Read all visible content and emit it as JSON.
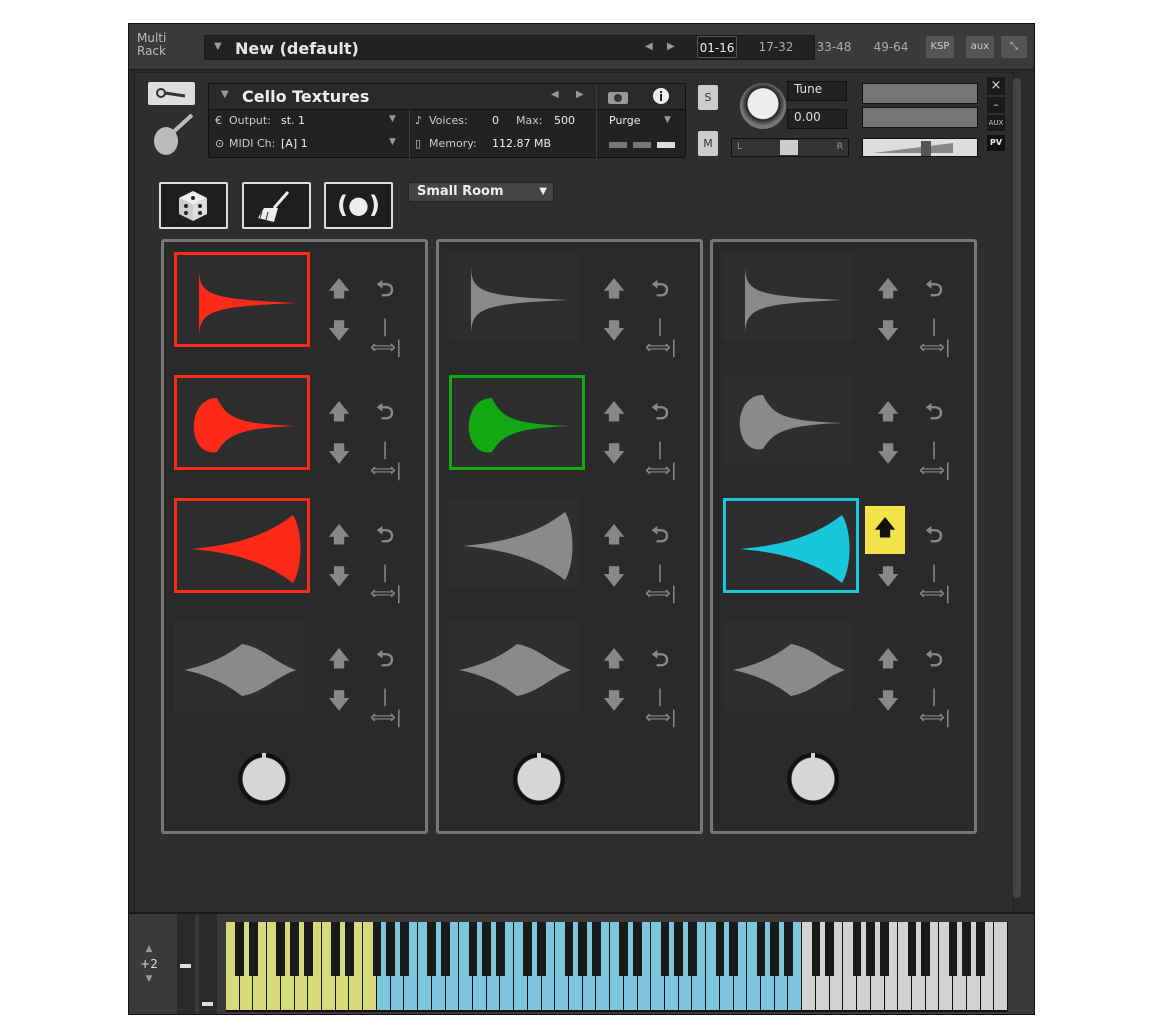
{
  "rack": {
    "title_line1": "Multi",
    "title_line2": "Rack",
    "name": "New (default)",
    "pages": [
      "01-16",
      "17-32",
      "33-48",
      "49-64"
    ],
    "active_page": "01-16",
    "ksp_label": "KSP",
    "aux_label": "aux"
  },
  "instrument": {
    "name": "Cello Textures",
    "output_label": "Output:",
    "output_value": "st. 1",
    "voices_label": "Voices:",
    "voices_value": "0",
    "max_label": "Max:",
    "max_value": "500",
    "midi_label": "MIDI Ch:",
    "midi_value": "[A]  1",
    "memory_label": "Memory:",
    "memory_value": "112.87 MB",
    "purge_label": "Purge",
    "solo_label": "S",
    "mute_label": "M",
    "tune_label": "Tune",
    "tune_value": "0.00",
    "pan_left": "L",
    "pan_right": "R",
    "aux_small": "AUX",
    "pv_label": "PV",
    "close_glyph": "×",
    "minimize_glyph": "–"
  },
  "controls": {
    "reverb_preset": "Small Room",
    "reverb_icon_text": "(●)"
  },
  "columns": [
    {
      "selected_slots": [
        0,
        1,
        2
      ],
      "selection_color": "#ff2a1a",
      "highlight_up_slot": null
    },
    {
      "selected_slots": [
        1
      ],
      "selection_color": "#12a812",
      "highlight_up_slot": null
    },
    {
      "selected_slots": [
        2
      ],
      "selection_color": "#19c6dc",
      "highlight_up_slot": 2
    }
  ],
  "keyboard": {
    "octave_shift": "+2",
    "ranges": [
      {
        "name": "yellow",
        "color": "#d8d97a"
      },
      {
        "name": "blue",
        "color": "#7ec6dc"
      },
      {
        "name": "gray",
        "color": "#d2d2d2"
      }
    ]
  }
}
